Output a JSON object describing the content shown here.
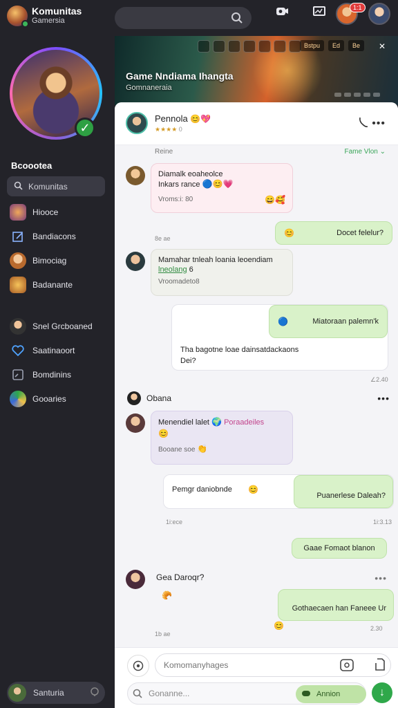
{
  "app": {
    "title": "Komunitas",
    "subtitle": "Gamersia",
    "accent": "#2fa84a"
  },
  "topbar": {
    "notification_count": "1:1",
    "icons": [
      "search-icon",
      "camera-icon",
      "cast-icon"
    ]
  },
  "sidebar": {
    "heading": "Bcoootea",
    "search_placeholder": "Komunitas",
    "items": [
      {
        "label": "Hiooce",
        "icon": "game-icon"
      },
      {
        "label": "Bandiacons",
        "icon": "edit-icon"
      },
      {
        "label": "Bimociag",
        "icon": "avatar-icon"
      },
      {
        "label": "Badanante",
        "icon": "puzzle-icon"
      }
    ],
    "items2": [
      {
        "label": "Snel Grcboaned",
        "icon": "character-icon"
      },
      {
        "label": "Saatinaoort",
        "icon": "heart-icon"
      },
      {
        "label": "Bomdinins",
        "icon": "square-icon"
      },
      {
        "label": "Gooaries",
        "icon": "hero-icon"
      }
    ],
    "bottom_user": "Santuria"
  },
  "banner": {
    "title": "Game Nndiama Ihangta",
    "subtitle": "Gomnaneraia",
    "tags": [
      "Bstpu",
      "Ed",
      "Be"
    ]
  },
  "chat": {
    "header": {
      "name": "Pennola",
      "rating": "★★★★",
      "rating_count": "0"
    },
    "section_left": "Reine",
    "section_right": "Fame Vlon",
    "messages": [
      {
        "line1": "Diamalk eoaheolce",
        "line2": "Inkars rance",
        "meta": "Vroms:i: 80"
      },
      {
        "text": "Docet felelur?"
      },
      {
        "time": "8e ae"
      },
      {
        "line1": "Mamahar tnleah loania leoendiam",
        "highlight": "lneolang",
        "line2_rest": "6",
        "meta": "Vroomadeto8"
      },
      {
        "top": "Miatoraan palemn'k",
        "body": "Tha bagotne loae dainsatdackaons",
        "body2": "Dei?",
        "time": "∠2.40"
      },
      {
        "sender": "Obana"
      },
      {
        "line1": "Menendiel lalet",
        "highlight": "Poraadeiles",
        "meta": "Booane soe"
      },
      {
        "left": "Pemgr daniobnde",
        "right": "Puanerlese Daleah?",
        "time": "1i:3.13"
      },
      {
        "time": "1i:ece"
      },
      {
        "text": "Gaae Fomaot blanon"
      },
      {
        "line1": "Gea Daroqr?",
        "time": "1b ae"
      },
      {
        "text": "Gothaecaen han Faneee Ur",
        "time": "2.30"
      }
    ]
  },
  "composer": {
    "input_placeholder": "Komomanyhages",
    "search_placeholder": "Gonanne...",
    "pill_label": "Annion"
  }
}
